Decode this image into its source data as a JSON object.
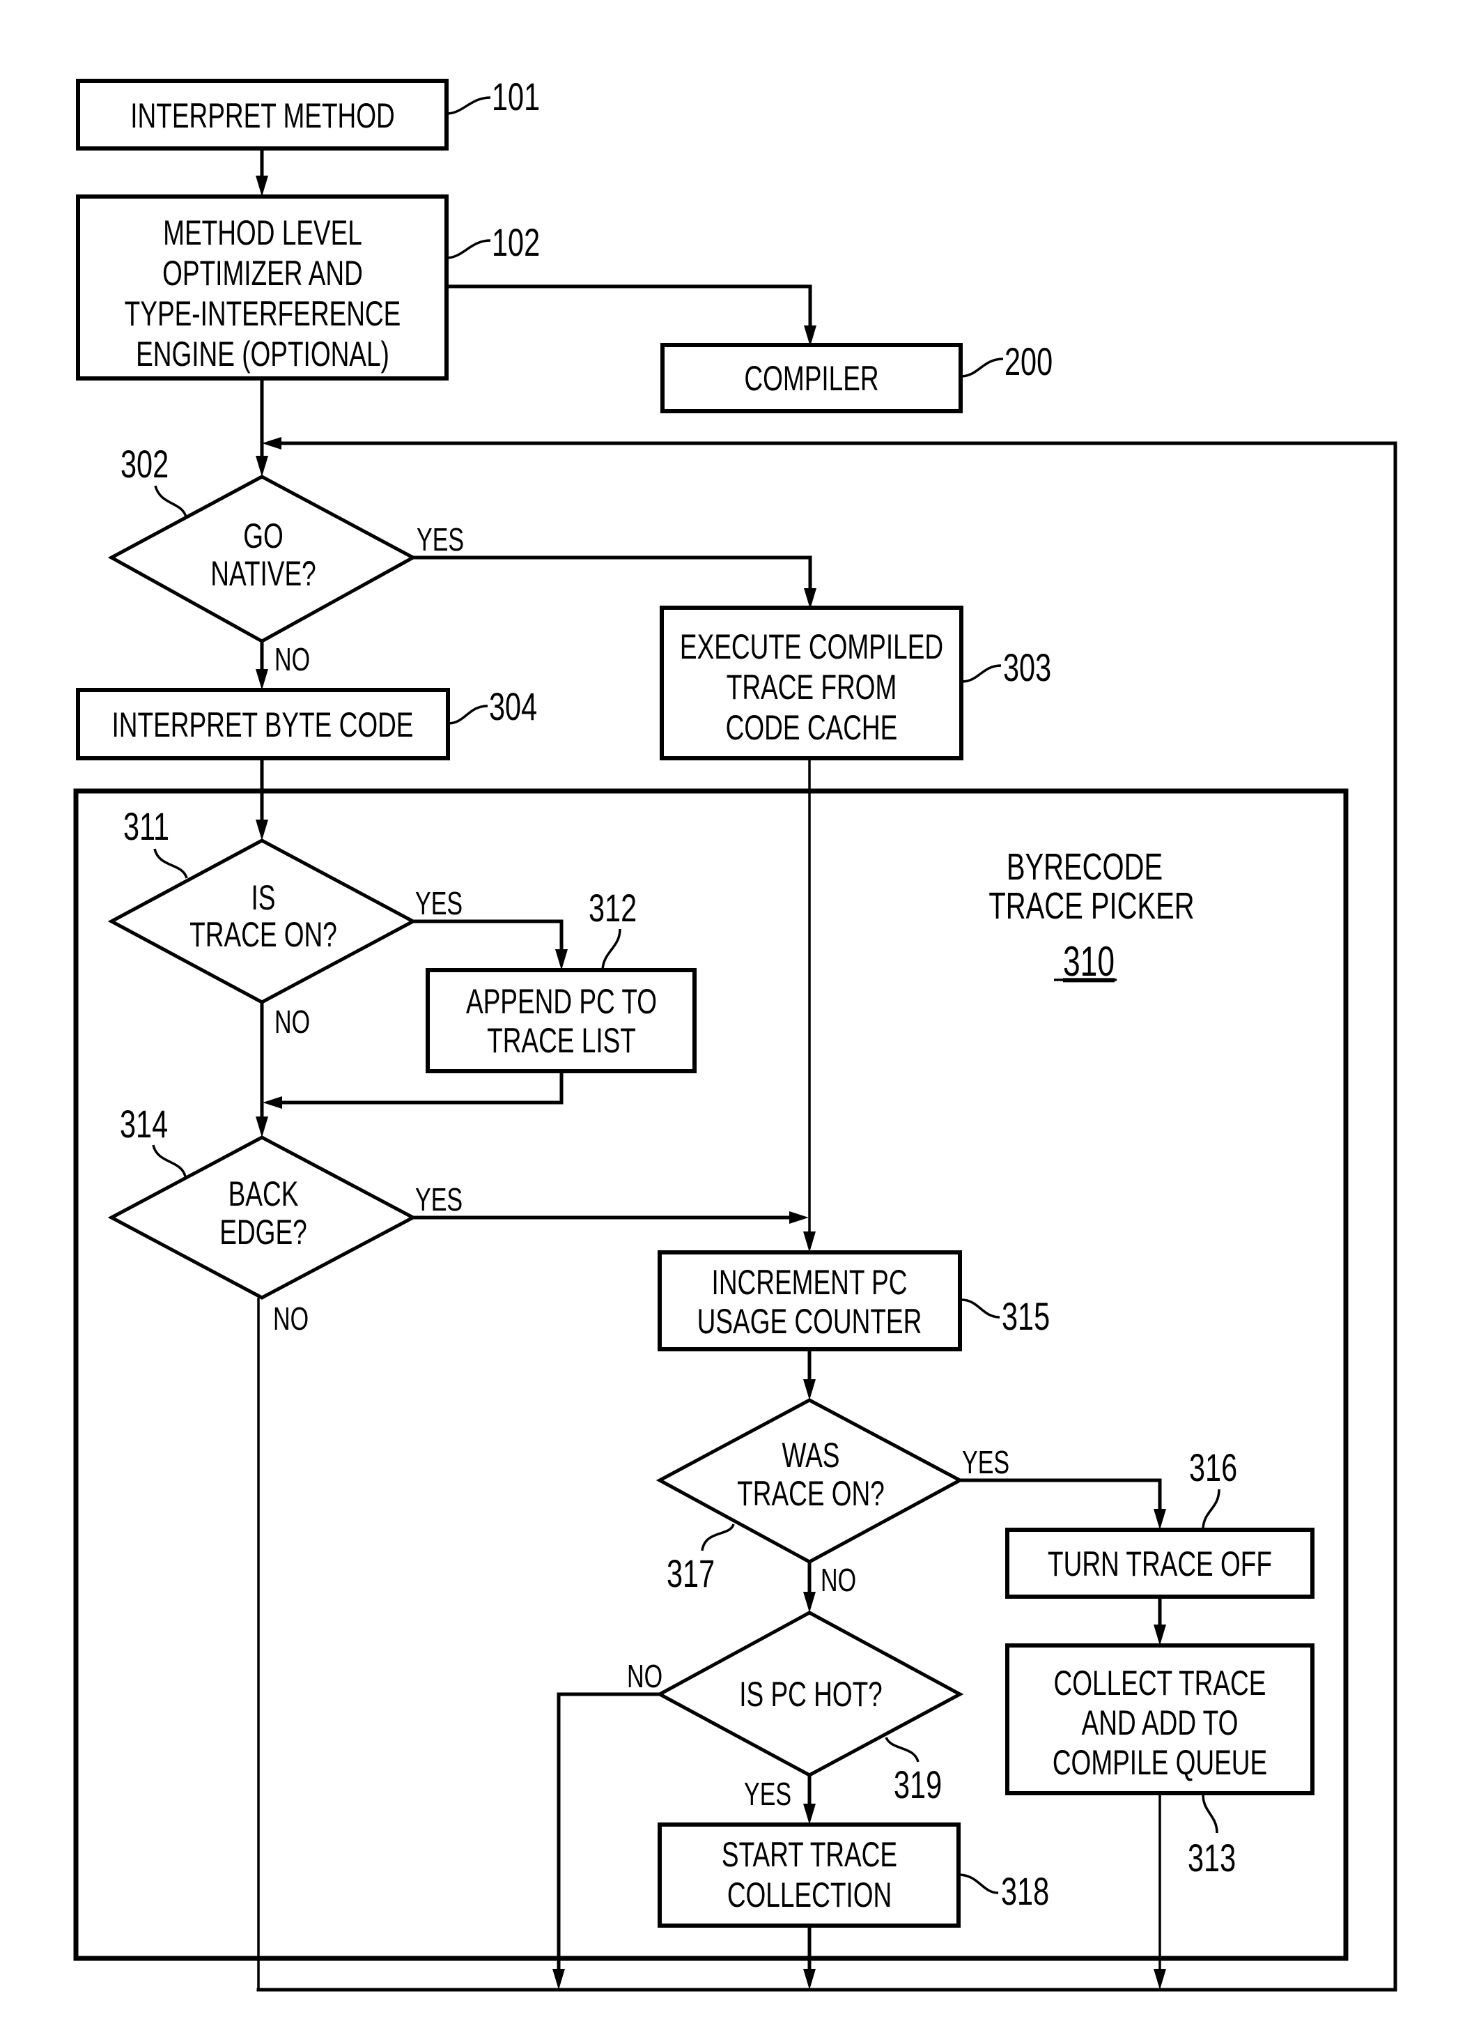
{
  "figure": {
    "title": "Bytecode trace picker flowchart",
    "nodes": {
      "interpret_method": {
        "ref": "101",
        "lines": [
          "INTERPRET METHOD"
        ]
      },
      "optimizer": {
        "ref": "102",
        "lines": [
          "METHOD LEVEL",
          "OPTIMIZER AND",
          "TYPE-INTERFERENCE",
          "ENGINE (OPTIONAL)"
        ]
      },
      "compiler": {
        "ref": "200",
        "lines": [
          "COMPILER"
        ]
      },
      "go_native": {
        "ref": "302",
        "lines": [
          "GO",
          "NATIVE?"
        ],
        "yes": "YES",
        "no": "NO"
      },
      "execute_compiled": {
        "ref": "303",
        "lines": [
          "EXECUTE COMPILED",
          "TRACE FROM",
          "CODE CACHE"
        ]
      },
      "interpret_bytecode": {
        "ref": "304",
        "lines": [
          "INTERPRET BYTE CODE"
        ]
      },
      "trace_picker": {
        "ref": "310",
        "lines": [
          "BYRECODE",
          "TRACE PICKER"
        ]
      },
      "is_trace_on": {
        "ref": "311",
        "lines": [
          "IS",
          "TRACE ON?"
        ],
        "yes": "YES",
        "no": "NO"
      },
      "append_pc": {
        "ref": "312",
        "lines": [
          "APPEND PC TO",
          "TRACE LIST"
        ]
      },
      "back_edge": {
        "ref": "314",
        "lines": [
          "BACK",
          "EDGE?"
        ],
        "yes": "YES",
        "no": "NO"
      },
      "increment_pc": {
        "ref": "315",
        "lines": [
          "INCREMENT PC",
          "USAGE COUNTER"
        ]
      },
      "was_trace_on": {
        "ref": "317",
        "lines": [
          "WAS",
          "TRACE ON?"
        ],
        "yes": "YES",
        "no": "NO"
      },
      "turn_trace_off": {
        "ref": "316",
        "lines": [
          "TURN TRACE OFF"
        ]
      },
      "collect_trace": {
        "ref": "313",
        "lines": [
          "COLLECT TRACE",
          "AND ADD TO",
          "COMPILE QUEUE"
        ]
      },
      "is_pc_hot": {
        "ref": "319",
        "lines": [
          "IS PC HOT?"
        ],
        "yes": "YES",
        "no": "NO"
      },
      "start_trace": {
        "ref": "318",
        "lines": [
          "START TRACE",
          "COLLECTION"
        ]
      }
    }
  }
}
